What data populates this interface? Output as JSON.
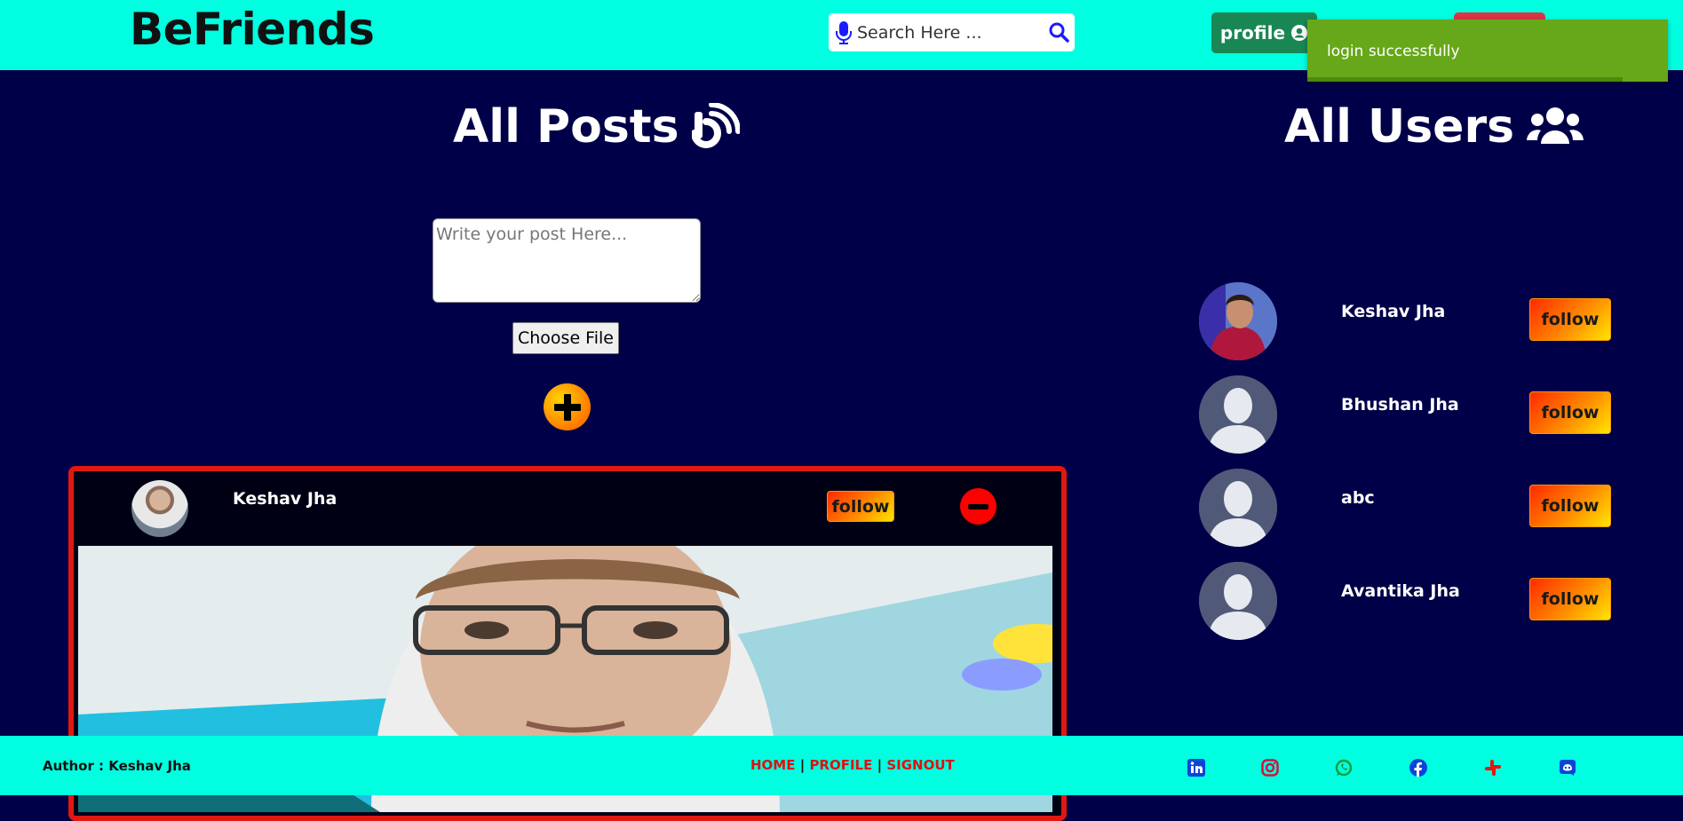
{
  "header": {
    "brand": "BeFriends",
    "search_placeholder": "Search Here ...",
    "profile_label": "profile",
    "colors": {
      "bar": "#00ffe0",
      "profile": "#198754",
      "logout": "#dc3545"
    }
  },
  "toast": {
    "message": "login successfully",
    "color": "#66a819"
  },
  "posts_section": {
    "title": "All Posts",
    "input_placeholder": "Write your post Here...",
    "file_button": "Choose File",
    "add_icon": "plus-circle-icon"
  },
  "post": {
    "author": "Keshav Jha",
    "follow_label": "follow",
    "remove_icon": "minus-circle-icon"
  },
  "users_section": {
    "title": "All Users",
    "users": [
      {
        "name": "Keshav Jha",
        "follow_label": "follow",
        "avatar": "photo"
      },
      {
        "name": "Bhushan Jha",
        "follow_label": "follow",
        "avatar": "default"
      },
      {
        "name": "abc",
        "follow_label": "follow",
        "avatar": "default"
      },
      {
        "name": "Avantika Jha",
        "follow_label": "follow",
        "avatar": "default"
      }
    ]
  },
  "footer": {
    "author": "Author : Keshav Jha",
    "links": [
      "HOME",
      "PROFILE",
      "SIGNOUT"
    ],
    "separator": "|",
    "social_icons": [
      "linkedin-icon",
      "instagram-icon",
      "whatsapp-icon",
      "facebook-icon",
      "slack-icon",
      "discord-icon"
    ]
  }
}
